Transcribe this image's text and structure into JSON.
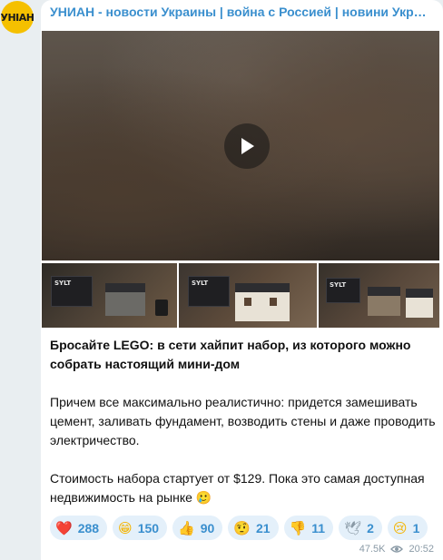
{
  "channel": {
    "avatar_text": "УНІАН",
    "title": "УНИАН - новости Украины | война с Россией | новини України | війна з Росією"
  },
  "media": {
    "kit_label_1": "SYLT",
    "kit_label_2": "SYLT",
    "kit_label_3": "SYLT"
  },
  "message": {
    "headline": "Бросайте LEGO: в сети хайпит набор, из которого можно собрать настоящий мини-дом",
    "paragraph_1": "Причем все максимально реалистично: придется замешивать цемент, заливать фундамент, возводить стены и даже проводить электричество.",
    "paragraph_2": "Стоимость набора стартует от $129. Пока это самая доступная недвижимость на рынке 🥲"
  },
  "reactions": [
    {
      "emoji": "❤️",
      "icon": "heart-icon",
      "count": "288"
    },
    {
      "emoji": "😁",
      "icon": "grin-icon",
      "count": "150"
    },
    {
      "emoji": "👍",
      "icon": "thumbs-up-icon",
      "count": "90"
    },
    {
      "emoji": "🤨",
      "icon": "skeptical-face-icon",
      "count": "21"
    },
    {
      "emoji": "👎",
      "icon": "thumbs-down-icon",
      "count": "11"
    },
    {
      "emoji": "🕊",
      "icon": "dove-icon",
      "count": "2"
    },
    {
      "emoji": "😢",
      "icon": "crying-face-icon",
      "count": "1"
    }
  ],
  "footer": {
    "views": "47.5K",
    "time": "20:52"
  },
  "colors": {
    "accent": "#3a8fce",
    "reaction_bg": "#e4f0fa",
    "avatar_bg": "#f5c000"
  }
}
